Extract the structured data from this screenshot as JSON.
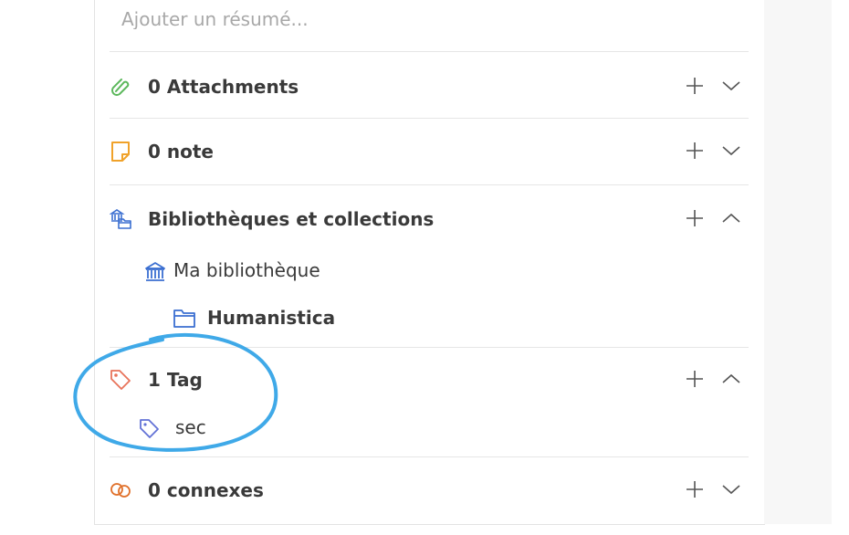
{
  "abstract": {
    "placeholder": "Ajouter un résumé..."
  },
  "sections": {
    "attachments": {
      "label": "0 Attachments"
    },
    "notes": {
      "label": "0 note"
    },
    "libraries": {
      "label": "Bibliothèques et collections",
      "library_name": "Ma bibliothèque",
      "collection_name": "Humanistica"
    },
    "tags": {
      "label": "1 Tag",
      "items": [
        "sec"
      ]
    },
    "related": {
      "label": "0 connexes"
    }
  },
  "colors": {
    "attachment_icon": "#5cb85c",
    "note_icon": "#f0a22a",
    "library_icon": "#3b6fd1",
    "tag_section_icon": "#e8735a",
    "tag_item_icon": "#6272d6",
    "related_icon": "#e0702a",
    "annotation_circle": "#3fa9e8"
  },
  "icons": {
    "attachments": "paperclip-icon",
    "notes": "note-icon",
    "libraries": "library-collection-icon",
    "library": "bank-building-icon",
    "collection": "folder-icon",
    "tag_section": "tag-icon",
    "tag_item": "tag-icon",
    "related": "link-chain-icon",
    "add": "plus-icon",
    "expand": "chevron-down-icon",
    "collapse": "chevron-up-icon"
  }
}
